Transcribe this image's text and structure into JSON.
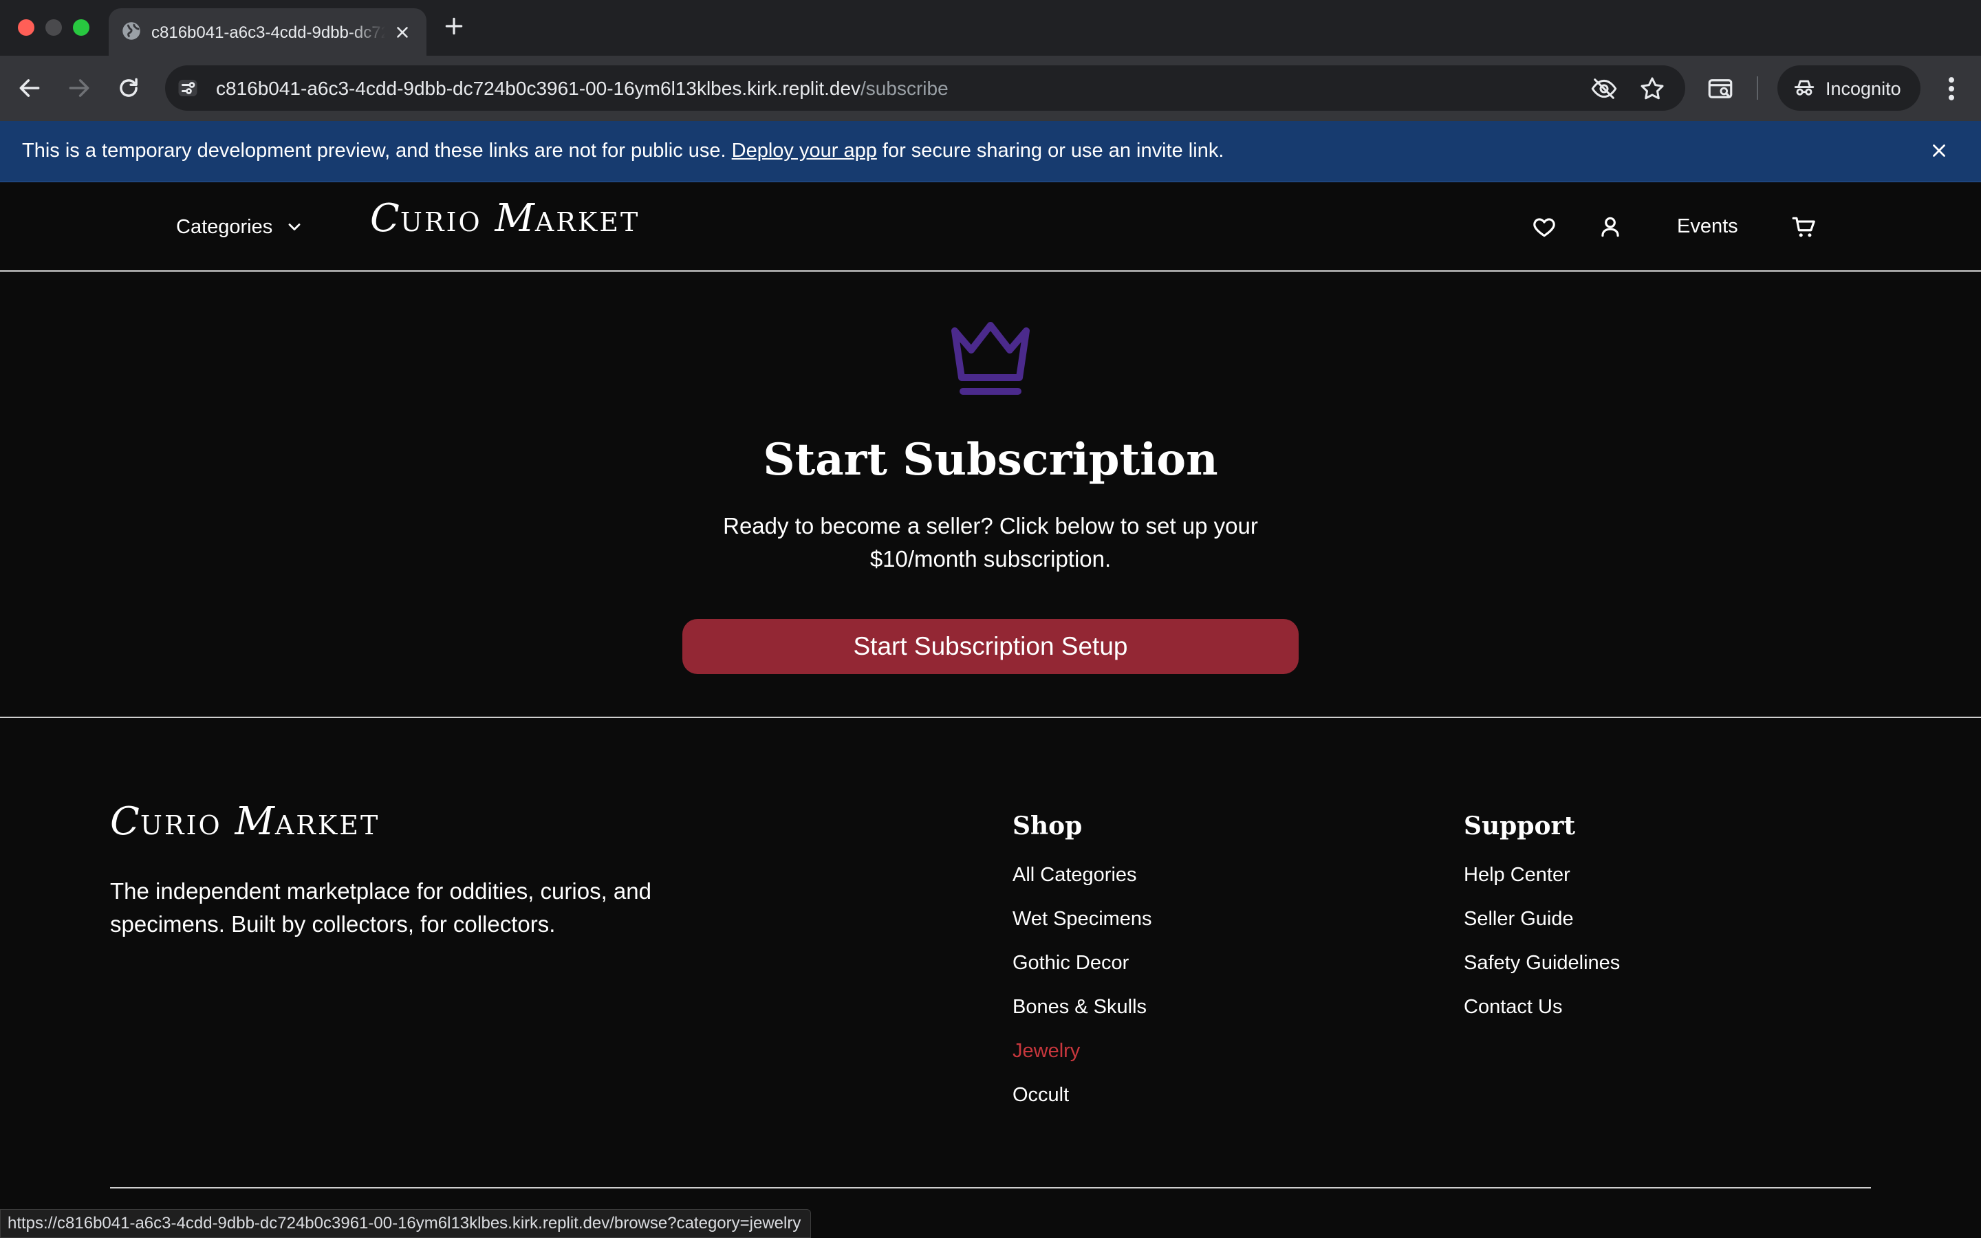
{
  "browser": {
    "tab_title": "c816b041-a6c3-4cdd-9dbb-dc724b0c3961-00-16ym6l13klbes.kirk.replit.dev/subscribe",
    "url_host": "c816b041-a6c3-4cdd-9dbb-dc724b0c3961-00-16ym6l13klbes.kirk.replit.dev",
    "url_path": "/subscribe",
    "incognito_label": "Incognito",
    "status_url": "https://c816b041-a6c3-4cdd-9dbb-dc724b0c3961-00-16ym6l13klbes.kirk.replit.dev/browse?category=jewelry"
  },
  "banner": {
    "text_before": "This is a temporary development preview, and these links are not for public use.",
    "link": "Deploy your app",
    "text_after": "for secure sharing or use an invite link."
  },
  "header": {
    "categories_label": "Categories",
    "logo_initial_1": "C",
    "logo_rest_1": "URIO",
    "logo_initial_2": "M",
    "logo_rest_2": "ARKET",
    "events_label": "Events"
  },
  "main": {
    "title": "Start Subscription",
    "description": "Ready to become a seller? Click below to set up your $10/month subscription.",
    "cta_label": "Start Subscription Setup"
  },
  "footer": {
    "tagline": "The independent marketplace for oddities, curios, and specimens. Built by collectors, for collectors.",
    "shop": {
      "heading": "Shop",
      "links": [
        "All Categories",
        "Wet Specimens",
        "Gothic Decor",
        "Bones & Skulls",
        "Jewelry",
        "Occult"
      ]
    },
    "support": {
      "heading": "Support",
      "links": [
        "Help Center",
        "Seller Guide",
        "Safety Guidelines",
        "Contact Us"
      ]
    }
  },
  "colors": {
    "accent_red": "#932734",
    "active_link_red": "#c8373d",
    "crown_purple": "#4b2a8c",
    "banner_blue": "#173b6f",
    "page_bg": "#0b0b0b"
  },
  "icons": {
    "header": [
      "heart-icon",
      "user-icon",
      "cart-icon"
    ],
    "hero": "crown-icon"
  }
}
